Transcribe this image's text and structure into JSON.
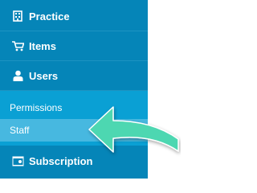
{
  "sidebar": {
    "items": [
      {
        "label": "Practice",
        "icon": "building-icon"
      },
      {
        "label": "Items",
        "icon": "cart-icon"
      },
      {
        "label": "Users",
        "icon": "user-icon"
      }
    ],
    "sub_items": [
      {
        "label": "Permissions"
      },
      {
        "label": "Staff"
      }
    ],
    "subscription": {
      "label": "Subscription",
      "icon": "billing-icon"
    }
  },
  "colors": {
    "sidebar_bg": "#0585b8",
    "submenu_bg": "#0aa0d4",
    "active_bg": "#47b8e0",
    "arrow": "#4ed7b1"
  }
}
